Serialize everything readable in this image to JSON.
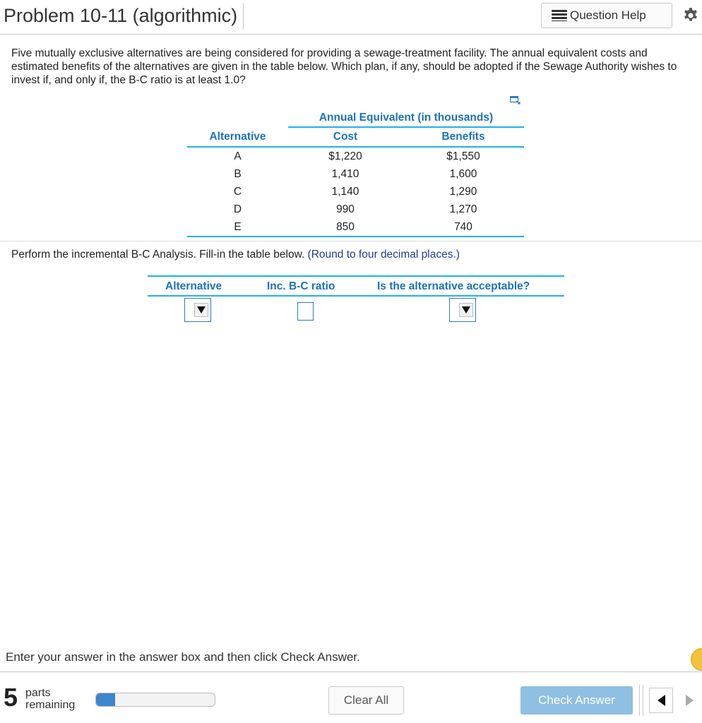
{
  "header": {
    "title": "Problem 10-11 (algorithmic)",
    "question_help_label": "Question Help"
  },
  "question": {
    "text": "Five mutually exclusive alternatives are being considered for providing a sewage-treatment facility. The annual equivalent costs and estimated benefits of the alternatives are given in the table below. Which plan, if any, should be adopted if the Sewage Authority wishes to invest if, and only if, the B-C ratio is at least 1.0?"
  },
  "data_table": {
    "group_header": "Annual Equivalent (in thousands)",
    "columns": [
      "Alternative",
      "Cost",
      "Benefits"
    ],
    "rows": [
      [
        "A",
        "$1,220",
        "$1,550"
      ],
      [
        "B",
        "1,410",
        "1,600"
      ],
      [
        "C",
        "1,140",
        "1,290"
      ],
      [
        "D",
        "990",
        "1,270"
      ],
      [
        "E",
        "850",
        "740"
      ]
    ]
  },
  "prompt": {
    "text": "Perform the incremental B-C Analysis. Fill-in the table below.",
    "hint": "(Round to four decimal places.)"
  },
  "answer_table": {
    "columns": [
      "Alternative",
      "Inc. B-C ratio",
      "Is the alternative acceptable?"
    ],
    "inc_bc_value": ""
  },
  "footer": {
    "instruction": "Enter your answer in the answer box and then click Check Answer.",
    "parts_count": "5",
    "parts_label_1": "parts",
    "parts_label_2": "remaining",
    "progress_fraction": 0.16,
    "clear_all_label": "Clear All",
    "check_answer_label": "Check Answer"
  }
}
